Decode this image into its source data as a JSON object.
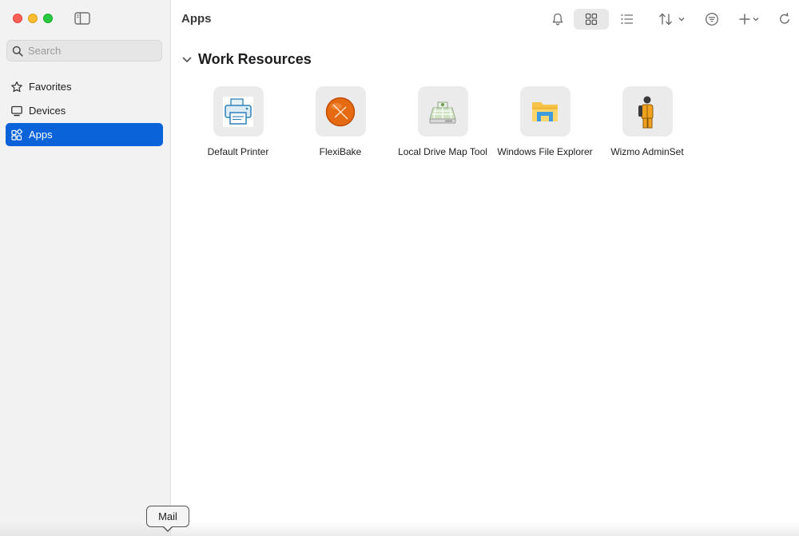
{
  "window": {
    "traffic_lights": {
      "close": "#fe5f57",
      "minimize": "#febc2e",
      "maximize": "#28c840"
    }
  },
  "sidebar": {
    "search": {
      "placeholder": "Search",
      "value": ""
    },
    "items": [
      {
        "label": "Favorites",
        "icon": "star-icon",
        "active": false
      },
      {
        "label": "Devices",
        "icon": "monitor-icon",
        "active": false
      },
      {
        "label": "Apps",
        "icon": "apps-icon",
        "active": true
      }
    ],
    "accent_color": "#0a63d9"
  },
  "toolbar": {
    "title": "Apps",
    "buttons": [
      "bell-icon",
      "grid-view-icon",
      "list-view-icon",
      "sort-icon",
      "filter-icon",
      "add-icon",
      "refresh-icon"
    ],
    "selected_view": "grid"
  },
  "section": {
    "title": "Work Resources",
    "apps": [
      {
        "label": "Default Printer",
        "icon": "printer-icon"
      },
      {
        "label": "FlexiBake",
        "icon": "flexibake-icon"
      },
      {
        "label": "Local Drive Map Tool",
        "icon": "drive-map-icon"
      },
      {
        "label": "Windows File Explorer",
        "icon": "folder-icon"
      },
      {
        "label": "Wizmo AdminSet",
        "icon": "admin-person-icon"
      }
    ]
  },
  "dock": {
    "tooltip": "Mail"
  }
}
